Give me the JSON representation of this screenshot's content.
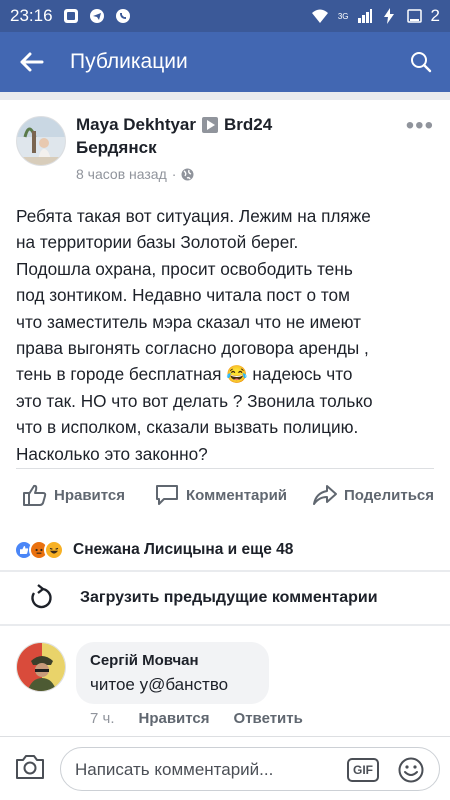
{
  "status_bar": {
    "time": "23:16",
    "network": "3G",
    "battery": "2"
  },
  "app_bar": {
    "title": "Публикации"
  },
  "post": {
    "author": "Maya Dekhtyar",
    "page": "Brd24",
    "city": "Бердянск",
    "time": "8 часов назад",
    "text_lines": [
      "Ребята такая вот ситуация. Лежим на пляже",
      "на территории базы Золотой берег.",
      "Подошла охрана, просит освободить тень",
      "под зонтиком. Недавно читала пост о том",
      "что заместитель мэра сказал что не имеют",
      "права выгонять согласно договора аренды ,",
      "тень в городе бесплатная 😂 надеюсь что",
      "это так. НО что вот делать ? Звонила только",
      "что в исполком, сказали вызвать полицию.",
      "Насколько это законно?"
    ]
  },
  "actions": {
    "like": "Нравится",
    "comment": "Комментарий",
    "share": "Поделиться"
  },
  "reactions": {
    "names": "Снежана Лисицына и еще 48",
    "icons": [
      "like-icon",
      "angry-icon",
      "haha-icon"
    ],
    "colors": {
      "like": "#4a86f7",
      "angry": "#e9710f",
      "haha": "#f7b125"
    }
  },
  "load_previous": "Загрузить предыдущие комментарии",
  "comment": {
    "author": "Сергій Мовчан",
    "text": "читое у@банство",
    "time": "7 ч.",
    "like": "Нравится",
    "reply": "Ответить"
  },
  "composer": {
    "placeholder": "Написать комментарий...",
    "gif": "GIF"
  },
  "colors": {
    "status_bar": "#3b5998",
    "app_bar": "#4267b2",
    "background": "#e9ebee"
  }
}
